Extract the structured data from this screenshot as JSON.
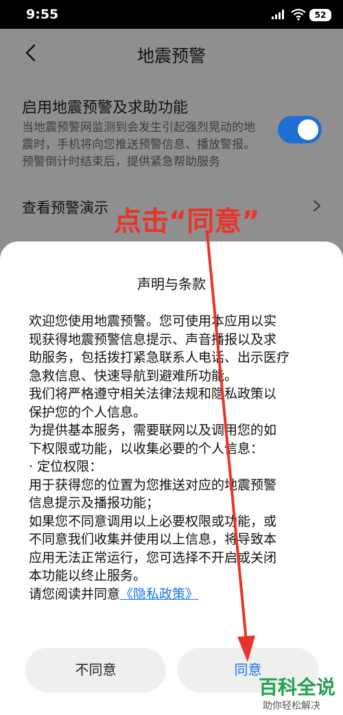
{
  "status": {
    "time": "9:55",
    "battery": "52"
  },
  "header": {
    "title": "地震预警"
  },
  "setting": {
    "title": "启用地震预警及求助功能",
    "desc": "当地震预警网监测到会发生引起强烈晃动的地震时，手机将向您推送预警信息、播放警报。预警倒计时结束后，提供紧急帮助服务",
    "enabled": true
  },
  "demo": {
    "label": "查看预警演示"
  },
  "dialog": {
    "title": "声明与条款",
    "lines": [
      "欢迎您使用地震预警。您可使用本应用以实",
      "现获得地震预警信息提示、声音播报以及求",
      "助服务，包括拨打紧急联系人电话、出示医疗",
      "急救信息、快速导航到避难所功能。",
      "我们将严格遵守相关法律法规和隐私政策以",
      "保护您的个人信息。",
      "为提供基本服务，需要联网以及调用您的如",
      "下权限或功能，以收集必要的个人信息：",
      "· 定位权限：",
      "用于获得您的位置为您推送对应的地震预警",
      "信息提示及播报功能；",
      "如果您不同意调用以上必要权限或功能，或",
      "不同意我们收集并使用以上信息，将导致本",
      "应用无法正常运行，您可选择不开启或关闭",
      "本功能以终止服务。"
    ],
    "last_line_prefix": "请您阅读并同意",
    "privacy_link": "《隐私政策》",
    "disagree": "不同意",
    "agree": "同意"
  },
  "annotation": "点击“同意”",
  "watermark": {
    "main": "百科全说",
    "sub": "助你轻松解决"
  },
  "colors": {
    "accent": "#1a73e8",
    "toggle": "#1f6fd2",
    "annotation": "#e8352b",
    "watermark": "#21a150"
  }
}
